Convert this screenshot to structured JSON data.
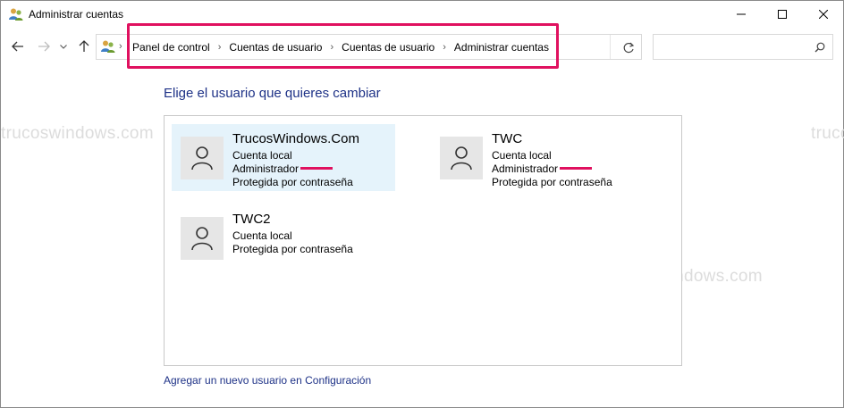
{
  "window": {
    "title": "Administrar cuentas",
    "icon": "user-accounts-icon"
  },
  "addressbar": {
    "breadcrumbs": [
      "Panel de control",
      "Cuentas de usuario",
      "Cuentas de usuario",
      "Administrar cuentas"
    ],
    "highlight_color": "#e0115f"
  },
  "search": {
    "placeholder": ""
  },
  "main": {
    "heading": "Elige el usuario que quieres cambiar",
    "accounts": [
      {
        "name": "TrucosWindows.Com",
        "lines": [
          "Cuenta local",
          "Administrador",
          "Protegida por contraseña"
        ],
        "selected": true,
        "admin_mark": true
      },
      {
        "name": "TWC",
        "lines": [
          "Cuenta local",
          "Administrador",
          "Protegida por contraseña"
        ],
        "selected": false,
        "admin_mark": true
      },
      {
        "name": "TWC2",
        "lines": [
          "Cuenta local",
          "Protegida por contraseña"
        ],
        "selected": false,
        "admin_mark": false
      }
    ],
    "add_user_link": "Agregar un nuevo usuario en Configuración"
  },
  "watermark": "trucoswindows.com",
  "colors": {
    "link": "#1e3287",
    "selection": "#e5f3fb",
    "accent_mark": "#e0115f"
  }
}
